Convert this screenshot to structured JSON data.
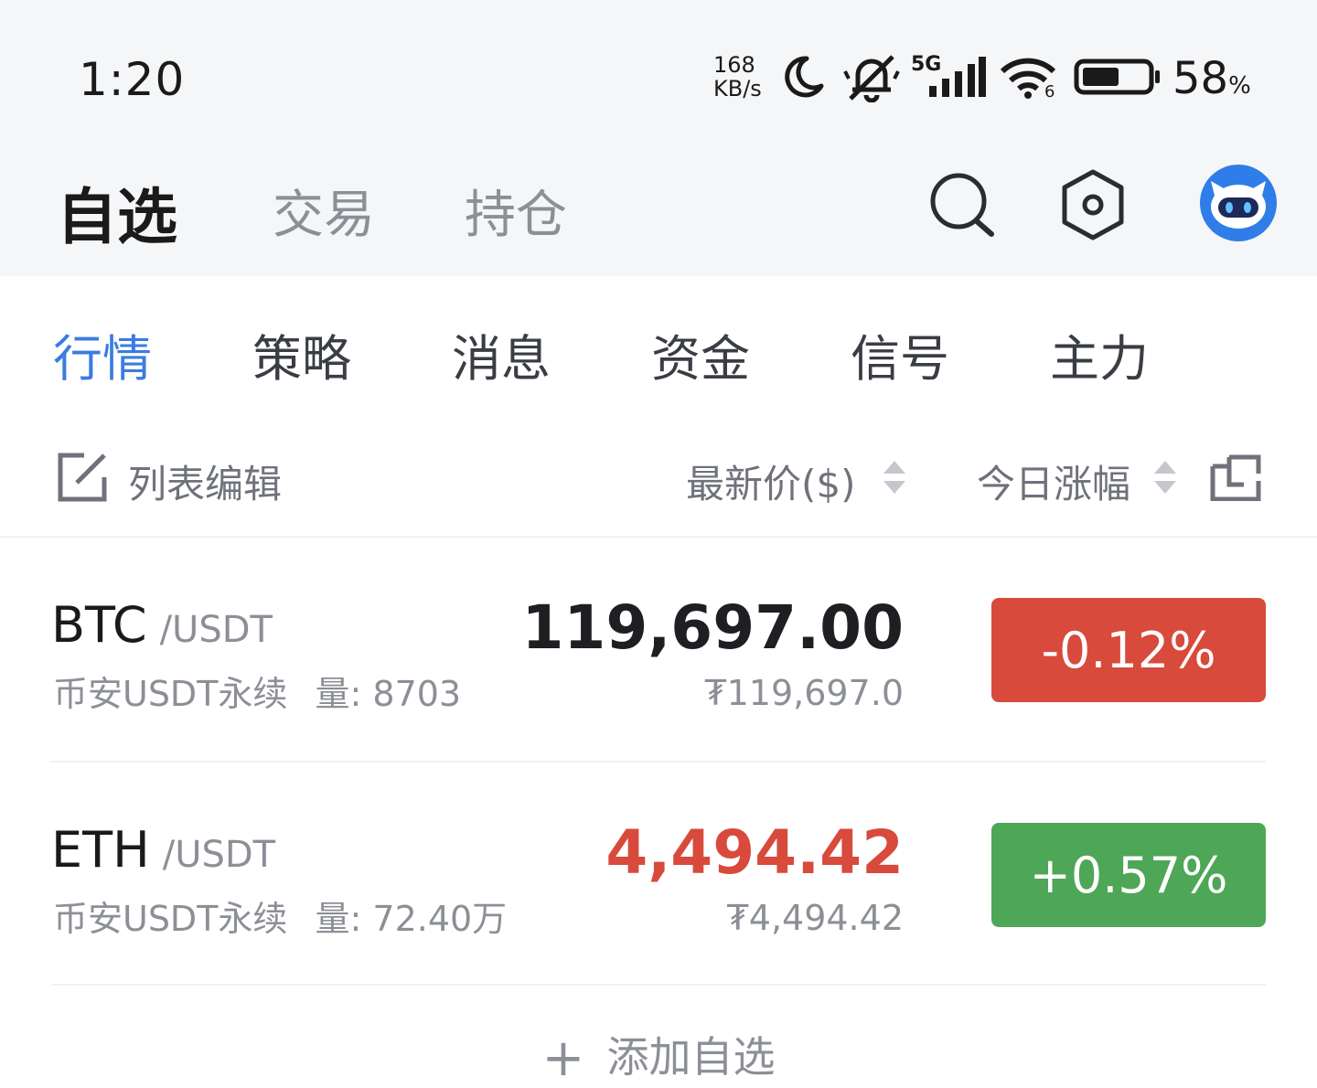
{
  "status_bar": {
    "time": "1:20",
    "speed_value": "168",
    "speed_unit": "KB/s",
    "network": "5G",
    "wifi_band": "6",
    "battery_percent": "58",
    "battery_percent_sign": "%",
    "battery_level": 0.58,
    "icons": [
      "moon-icon",
      "bell-muted-icon",
      "signal-icon",
      "wifi-icon",
      "battery-icon"
    ]
  },
  "top_nav": {
    "tabs": [
      {
        "label": "自选",
        "active": true
      },
      {
        "label": "交易",
        "active": false
      },
      {
        "label": "持仓",
        "active": false
      }
    ],
    "icons": [
      "search-icon",
      "settings-hexagon-icon",
      "robot-avatar-icon"
    ]
  },
  "sub_tabs": [
    {
      "label": "行情",
      "active": true
    },
    {
      "label": "策略",
      "active": false
    },
    {
      "label": "消息",
      "active": false
    },
    {
      "label": "资金",
      "active": false
    },
    {
      "label": "信号",
      "active": false
    },
    {
      "label": "主力",
      "active": false
    }
  ],
  "list_header": {
    "edit_label": "列表编辑",
    "price_col": "最新价($)",
    "change_col": "今日涨幅"
  },
  "rows": [
    {
      "symbol": "BTC",
      "quote": "/USDT",
      "exchange": "币安USDT永续",
      "volume": "量: 8703",
      "price": "119,697.00",
      "price_color": "#1e1f22",
      "cny": "₮119,697.0",
      "change": "-0.12%",
      "change_color": "#d84a3c"
    },
    {
      "symbol": "ETH",
      "quote": "/USDT",
      "exchange": "币安USDT永续",
      "volume": "量: 72.40万",
      "price": "4,494.42",
      "price_color": "#d84a3c",
      "cny": "₮4,494.42",
      "change": "+0.57%",
      "change_color": "#4ea657"
    }
  ],
  "add_label": "添加自选"
}
